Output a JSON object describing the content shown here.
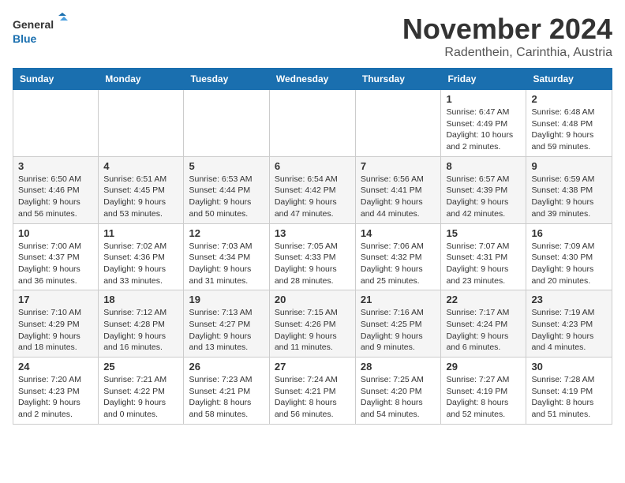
{
  "logo": {
    "line1": "General",
    "line2": "Blue"
  },
  "title": "November 2024",
  "location": "Radenthein, Carinthia, Austria",
  "weekdays": [
    "Sunday",
    "Monday",
    "Tuesday",
    "Wednesday",
    "Thursday",
    "Friday",
    "Saturday"
  ],
  "weeks": [
    [
      {
        "day": "",
        "info": ""
      },
      {
        "day": "",
        "info": ""
      },
      {
        "day": "",
        "info": ""
      },
      {
        "day": "",
        "info": ""
      },
      {
        "day": "",
        "info": ""
      },
      {
        "day": "1",
        "info": "Sunrise: 6:47 AM\nSunset: 4:49 PM\nDaylight: 10 hours\nand 2 minutes."
      },
      {
        "day": "2",
        "info": "Sunrise: 6:48 AM\nSunset: 4:48 PM\nDaylight: 9 hours\nand 59 minutes."
      }
    ],
    [
      {
        "day": "3",
        "info": "Sunrise: 6:50 AM\nSunset: 4:46 PM\nDaylight: 9 hours\nand 56 minutes."
      },
      {
        "day": "4",
        "info": "Sunrise: 6:51 AM\nSunset: 4:45 PM\nDaylight: 9 hours\nand 53 minutes."
      },
      {
        "day": "5",
        "info": "Sunrise: 6:53 AM\nSunset: 4:44 PM\nDaylight: 9 hours\nand 50 minutes."
      },
      {
        "day": "6",
        "info": "Sunrise: 6:54 AM\nSunset: 4:42 PM\nDaylight: 9 hours\nand 47 minutes."
      },
      {
        "day": "7",
        "info": "Sunrise: 6:56 AM\nSunset: 4:41 PM\nDaylight: 9 hours\nand 44 minutes."
      },
      {
        "day": "8",
        "info": "Sunrise: 6:57 AM\nSunset: 4:39 PM\nDaylight: 9 hours\nand 42 minutes."
      },
      {
        "day": "9",
        "info": "Sunrise: 6:59 AM\nSunset: 4:38 PM\nDaylight: 9 hours\nand 39 minutes."
      }
    ],
    [
      {
        "day": "10",
        "info": "Sunrise: 7:00 AM\nSunset: 4:37 PM\nDaylight: 9 hours\nand 36 minutes."
      },
      {
        "day": "11",
        "info": "Sunrise: 7:02 AM\nSunset: 4:36 PM\nDaylight: 9 hours\nand 33 minutes."
      },
      {
        "day": "12",
        "info": "Sunrise: 7:03 AM\nSunset: 4:34 PM\nDaylight: 9 hours\nand 31 minutes."
      },
      {
        "day": "13",
        "info": "Sunrise: 7:05 AM\nSunset: 4:33 PM\nDaylight: 9 hours\nand 28 minutes."
      },
      {
        "day": "14",
        "info": "Sunrise: 7:06 AM\nSunset: 4:32 PM\nDaylight: 9 hours\nand 25 minutes."
      },
      {
        "day": "15",
        "info": "Sunrise: 7:07 AM\nSunset: 4:31 PM\nDaylight: 9 hours\nand 23 minutes."
      },
      {
        "day": "16",
        "info": "Sunrise: 7:09 AM\nSunset: 4:30 PM\nDaylight: 9 hours\nand 20 minutes."
      }
    ],
    [
      {
        "day": "17",
        "info": "Sunrise: 7:10 AM\nSunset: 4:29 PM\nDaylight: 9 hours\nand 18 minutes."
      },
      {
        "day": "18",
        "info": "Sunrise: 7:12 AM\nSunset: 4:28 PM\nDaylight: 9 hours\nand 16 minutes."
      },
      {
        "day": "19",
        "info": "Sunrise: 7:13 AM\nSunset: 4:27 PM\nDaylight: 9 hours\nand 13 minutes."
      },
      {
        "day": "20",
        "info": "Sunrise: 7:15 AM\nSunset: 4:26 PM\nDaylight: 9 hours\nand 11 minutes."
      },
      {
        "day": "21",
        "info": "Sunrise: 7:16 AM\nSunset: 4:25 PM\nDaylight: 9 hours\nand 9 minutes."
      },
      {
        "day": "22",
        "info": "Sunrise: 7:17 AM\nSunset: 4:24 PM\nDaylight: 9 hours\nand 6 minutes."
      },
      {
        "day": "23",
        "info": "Sunrise: 7:19 AM\nSunset: 4:23 PM\nDaylight: 9 hours\nand 4 minutes."
      }
    ],
    [
      {
        "day": "24",
        "info": "Sunrise: 7:20 AM\nSunset: 4:23 PM\nDaylight: 9 hours\nand 2 minutes."
      },
      {
        "day": "25",
        "info": "Sunrise: 7:21 AM\nSunset: 4:22 PM\nDaylight: 9 hours\nand 0 minutes."
      },
      {
        "day": "26",
        "info": "Sunrise: 7:23 AM\nSunset: 4:21 PM\nDaylight: 8 hours\nand 58 minutes."
      },
      {
        "day": "27",
        "info": "Sunrise: 7:24 AM\nSunset: 4:21 PM\nDaylight: 8 hours\nand 56 minutes."
      },
      {
        "day": "28",
        "info": "Sunrise: 7:25 AM\nSunset: 4:20 PM\nDaylight: 8 hours\nand 54 minutes."
      },
      {
        "day": "29",
        "info": "Sunrise: 7:27 AM\nSunset: 4:19 PM\nDaylight: 8 hours\nand 52 minutes."
      },
      {
        "day": "30",
        "info": "Sunrise: 7:28 AM\nSunset: 4:19 PM\nDaylight: 8 hours\nand 51 minutes."
      }
    ]
  ]
}
